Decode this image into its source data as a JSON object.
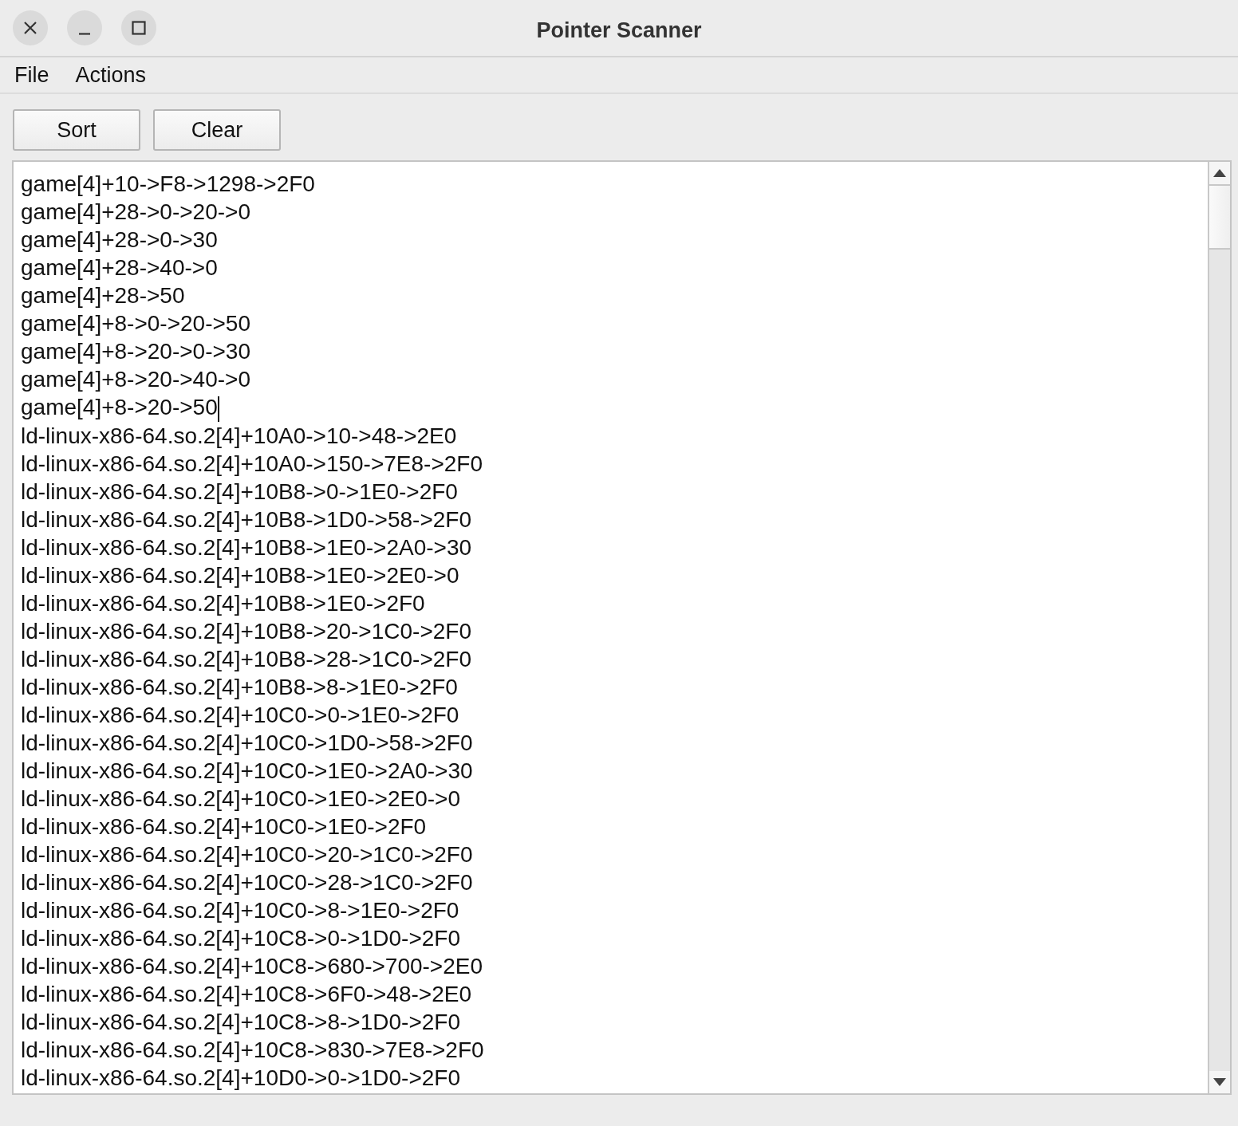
{
  "window": {
    "title": "Pointer Scanner"
  },
  "menu": [
    "File",
    "Actions"
  ],
  "buttons": [
    "Sort",
    "Clear"
  ],
  "text_area": {
    "lines": [
      {
        "text": "game[4]+10->F8->1298->2F0",
        "caret": false
      },
      {
        "text": "game[4]+28->0->20->0",
        "caret": false
      },
      {
        "text": "game[4]+28->0->30",
        "caret": false
      },
      {
        "text": "game[4]+28->40->0",
        "caret": false
      },
      {
        "text": "game[4]+28->50",
        "caret": false
      },
      {
        "text": "game[4]+8->0->20->50",
        "caret": false
      },
      {
        "text": "game[4]+8->20->0->30",
        "caret": false
      },
      {
        "text": "game[4]+8->20->40->0",
        "caret": false
      },
      {
        "text": "game[4]+8->20->50",
        "caret": true
      },
      {
        "text": "ld-linux-x86-64.so.2[4]+10A0->10->48->2E0",
        "caret": false
      },
      {
        "text": "ld-linux-x86-64.so.2[4]+10A0->150->7E8->2F0",
        "caret": false
      },
      {
        "text": "ld-linux-x86-64.so.2[4]+10B8->0->1E0->2F0",
        "caret": false
      },
      {
        "text": "ld-linux-x86-64.so.2[4]+10B8->1D0->58->2F0",
        "caret": false
      },
      {
        "text": "ld-linux-x86-64.so.2[4]+10B8->1E0->2A0->30",
        "caret": false
      },
      {
        "text": "ld-linux-x86-64.so.2[4]+10B8->1E0->2E0->0",
        "caret": false
      },
      {
        "text": "ld-linux-x86-64.so.2[4]+10B8->1E0->2F0",
        "caret": false
      },
      {
        "text": "ld-linux-x86-64.so.2[4]+10B8->20->1C0->2F0",
        "caret": false
      },
      {
        "text": "ld-linux-x86-64.so.2[4]+10B8->28->1C0->2F0",
        "caret": false
      },
      {
        "text": "ld-linux-x86-64.so.2[4]+10B8->8->1E0->2F0",
        "caret": false
      },
      {
        "text": "ld-linux-x86-64.so.2[4]+10C0->0->1E0->2F0",
        "caret": false
      },
      {
        "text": "ld-linux-x86-64.so.2[4]+10C0->1D0->58->2F0",
        "caret": false
      },
      {
        "text": "ld-linux-x86-64.so.2[4]+10C0->1E0->2A0->30",
        "caret": false
      },
      {
        "text": "ld-linux-x86-64.so.2[4]+10C0->1E0->2E0->0",
        "caret": false
      },
      {
        "text": "ld-linux-x86-64.so.2[4]+10C0->1E0->2F0",
        "caret": false
      },
      {
        "text": "ld-linux-x86-64.so.2[4]+10C0->20->1C0->2F0",
        "caret": false
      },
      {
        "text": "ld-linux-x86-64.so.2[4]+10C0->28->1C0->2F0",
        "caret": false
      },
      {
        "text": "ld-linux-x86-64.so.2[4]+10C0->8->1E0->2F0",
        "caret": false
      },
      {
        "text": "ld-linux-x86-64.so.2[4]+10C8->0->1D0->2F0",
        "caret": false
      },
      {
        "text": "ld-linux-x86-64.so.2[4]+10C8->680->700->2E0",
        "caret": false
      },
      {
        "text": "ld-linux-x86-64.so.2[4]+10C8->6F0->48->2E0",
        "caret": false
      },
      {
        "text": "ld-linux-x86-64.so.2[4]+10C8->8->1D0->2F0",
        "caret": false
      },
      {
        "text": "ld-linux-x86-64.so.2[4]+10C8->830->7E8->2F0",
        "caret": false
      },
      {
        "text": "ld-linux-x86-64.so.2[4]+10D0->0->1D0->2F0",
        "caret": false
      }
    ]
  }
}
